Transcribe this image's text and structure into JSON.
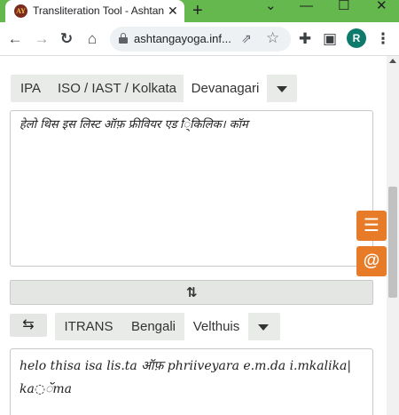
{
  "browser": {
    "tab_title": "Transliteration Tool - Ashtanga",
    "tab_favicon": "AY",
    "tab_close": "✕",
    "new_tab": "+",
    "window_controls": {
      "chevron": "⌄",
      "minimize": "—",
      "maximize": "☐",
      "close": "✕"
    },
    "url": "ashtangayoga.inf...",
    "profile_initial": "R"
  },
  "source": {
    "options": [
      "IPA",
      "ISO / IAST / Kolkata",
      "Devanagari"
    ],
    "selected": "Devanagari",
    "text": "हेलो थिस इस लिस्ट ऑफ़ फ्रीवियर एड ि्किलिक। कॉम"
  },
  "target": {
    "options": [
      "ITRANS",
      "Bengali",
      "Velthuis"
    ],
    "selected": "Velthuis",
    "text": "helo thisa isa lis.ta ऑफ़ phriiveyara e.m.da i.mkalika| ka◌ॅma"
  },
  "icons": {
    "back": "←",
    "forward": "→",
    "reload": "↻",
    "home": "⌂",
    "share": "⇗",
    "star": "☆",
    "extensions": "✚",
    "sidepanel": "▣",
    "more": "⋮",
    "convert": "⇅",
    "swap": "⇆",
    "menu": "☰",
    "at": "@"
  }
}
